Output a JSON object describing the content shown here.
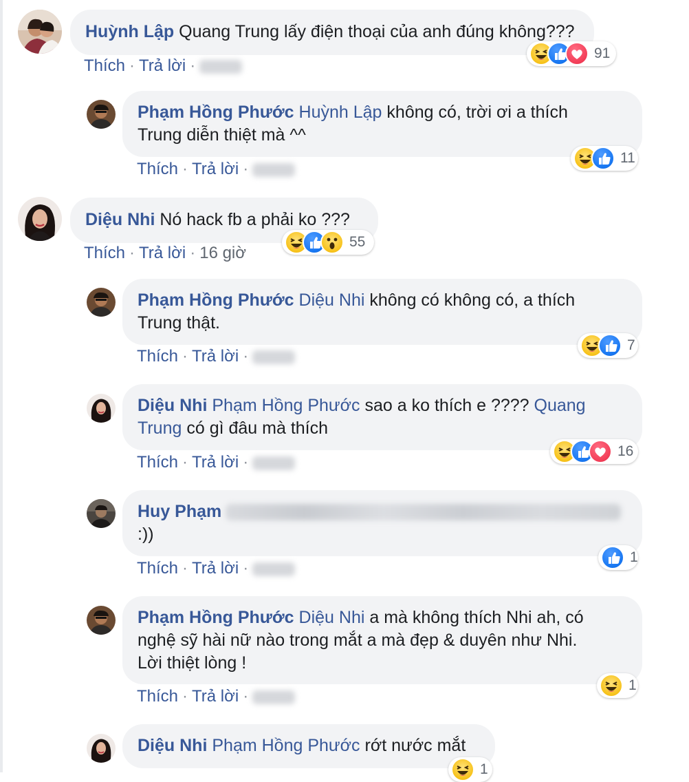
{
  "common": {
    "like": "Thích",
    "reply": "Trả lời",
    "sep": "·"
  },
  "comments": [
    {
      "author": "Huỳnh Lập",
      "text": "Quang Trung lấy điện thoại của anh đúng không???",
      "reactions": [
        "haha",
        "like",
        "love"
      ],
      "count": "91"
    },
    {
      "author": "Phạm Hồng Phước",
      "tag": "Huỳnh Lập",
      "text": "không có, trời ơi a thích",
      "text2": "Trung diễn thiệt mà ^^",
      "reactions": [
        "haha",
        "like"
      ],
      "count": "11"
    },
    {
      "author": "Diệu Nhi",
      "text": "Nó hack fb a phải ko ???",
      "time": "16 giờ",
      "reactions": [
        "haha",
        "like",
        "wow"
      ],
      "count": "55"
    },
    {
      "author": "Phạm Hồng Phước",
      "tag": "Diệu Nhi",
      "text": "không có không có, a thích",
      "text2": "Trung thật.",
      "reactions": [
        "haha",
        "like"
      ],
      "count": "7"
    },
    {
      "author": "Diệu Nhi",
      "tag": "Phạm Hồng Phước",
      "text": "sao a ko thích e ????",
      "tag2": "Quang",
      "tag3": "Trung",
      "text2": "có gì đâu mà thích",
      "reactions": [
        "haha",
        "like",
        "love"
      ],
      "count": "16"
    },
    {
      "author": "Huy Phạm",
      "text2": ":))",
      "reactions": [
        "like"
      ],
      "count": "1"
    },
    {
      "author": "Phạm Hồng Phước",
      "tag": "Diệu Nhi",
      "text": "a mà không thích Nhi ah, có",
      "text2": "nghệ sỹ hài nữ nào trong mắt a mà đẹp & duyên như Nhi.",
      "text3": "Lời thiệt lòng !",
      "reactions": [
        "haha"
      ],
      "count": "1"
    },
    {
      "author": "Diệu Nhi",
      "tag": "Phạm Hồng Phước",
      "text": "rớt nước mắt",
      "reactions": [
        "haha"
      ],
      "count": "1"
    }
  ]
}
